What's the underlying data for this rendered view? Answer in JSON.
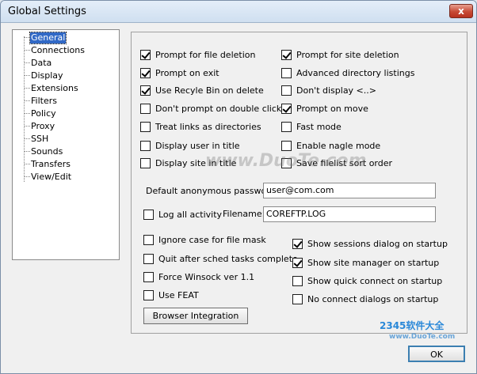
{
  "window": {
    "title": "Global Settings",
    "close_glyph": "x"
  },
  "tree": {
    "items": [
      {
        "label": "General",
        "selected": true
      },
      {
        "label": "Connections"
      },
      {
        "label": "Data"
      },
      {
        "label": "Display"
      },
      {
        "label": "Extensions"
      },
      {
        "label": "Filters"
      },
      {
        "label": "Policy"
      },
      {
        "label": "Proxy"
      },
      {
        "label": "SSH"
      },
      {
        "label": "Sounds"
      },
      {
        "label": "Transfers"
      },
      {
        "label": "View/Edit"
      }
    ]
  },
  "left_options": [
    {
      "label": "Prompt for file deletion",
      "checked": true
    },
    {
      "label": "Prompt on exit",
      "checked": true
    },
    {
      "label": "Use Recyle Bin on delete",
      "checked": true
    },
    {
      "label": "Don't prompt on double click",
      "checked": false
    },
    {
      "label": "Treat links as directories",
      "checked": false
    },
    {
      "label": "Display user in title",
      "checked": false
    },
    {
      "label": "Display site in title",
      "checked": false
    }
  ],
  "right_options": [
    {
      "label": "Prompt for site deletion",
      "checked": true
    },
    {
      "label": "Advanced directory listings",
      "checked": false
    },
    {
      "label": "Don't display <..>",
      "checked": false
    },
    {
      "label": "Prompt on move",
      "checked": true
    },
    {
      "label": "Fast mode",
      "checked": false
    },
    {
      "label": "Enable nagle mode",
      "checked": false
    },
    {
      "label": "Save filelist sort order",
      "checked": false
    }
  ],
  "anon_password": {
    "label": "Default anonymous password:",
    "value": "user@com.com"
  },
  "log_all": {
    "label": "Log all activity",
    "checked": false
  },
  "filename": {
    "label": "Filename:",
    "value": "COREFTP.LOG"
  },
  "lower_left_options": [
    {
      "label": "Ignore case for file mask",
      "checked": false
    },
    {
      "label": "Quit after sched tasks complete",
      "checked": false
    },
    {
      "label": "Force Winsock ver 1.1",
      "checked": false
    },
    {
      "label": "Use FEAT",
      "checked": false
    }
  ],
  "lower_right_options": [
    {
      "label": "Show sessions dialog on startup",
      "checked": true
    },
    {
      "label": "Show site manager on startup",
      "checked": true
    },
    {
      "label": "Show quick connect on startup",
      "checked": false
    },
    {
      "label": "No connect dialogs on startup",
      "checked": false
    }
  ],
  "buttons": {
    "browser_integration": "Browser Integration",
    "ok": "OK"
  },
  "watermarks": {
    "center": "www.DuoTe.com",
    "brand": "2345软件大全",
    "brand_url": "www.DuoTe.com"
  }
}
